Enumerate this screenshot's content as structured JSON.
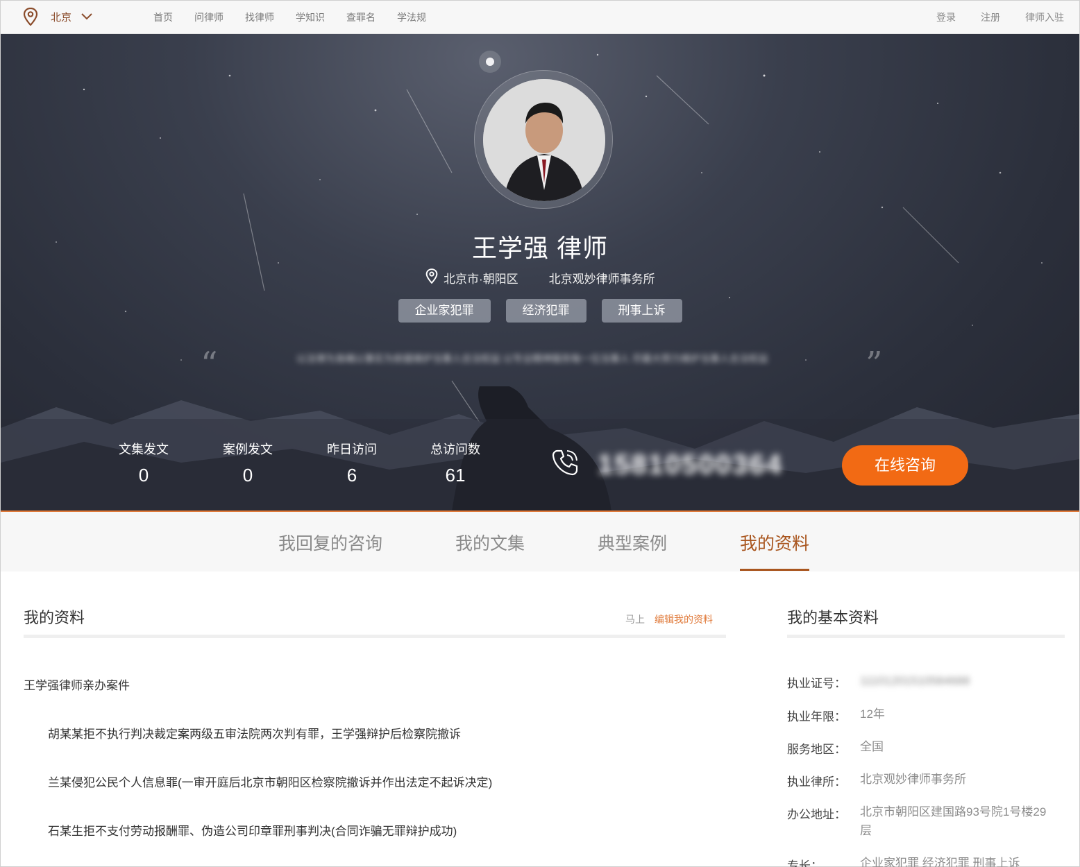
{
  "nav": {
    "city": "北京",
    "menu": [
      "首页",
      "问律师",
      "找律师",
      "学知识",
      "查罪名",
      "学法规"
    ],
    "right": [
      "登录",
      "注册",
      "律师入驻"
    ]
  },
  "profile": {
    "name": "王学强 律师",
    "location": "北京市·朝阳区",
    "firm": "北京观妙律师事务所",
    "tags": [
      "企业家犯罪",
      "经济犯罪",
      "刑事上诉"
    ],
    "quote_open": "“",
    "quote_close": "”",
    "motto": "以法律为准绳以事实为依据维护当事人合法权益 以专业精神服务每一位当事人 尽最大努力维护当事人合法权益"
  },
  "stats": [
    {
      "label": "文集发文",
      "value": "0"
    },
    {
      "label": "案例发文",
      "value": "0"
    },
    {
      "label": "昨日访问",
      "value": "6"
    },
    {
      "label": "总访问数",
      "value": "61"
    }
  ],
  "phone": "15810500364",
  "consult_label": "在线咨询",
  "tabs": [
    {
      "label": "我回复的咨询",
      "active": false
    },
    {
      "label": "我的文集",
      "active": false
    },
    {
      "label": "典型案例",
      "active": false
    },
    {
      "label": "我的资料",
      "active": true
    }
  ],
  "main": {
    "title": "我的资料",
    "edit_prefix": "马上",
    "edit_link": "编辑我的资料",
    "case_heading": "王学强律师亲办案件",
    "cases": [
      "胡某某拒不执行判决裁定案两级五审法院两次判有罪，王学强辩护后检察院撤诉",
      "兰某侵犯公民个人信息罪(一审开庭后北京市朝阳区检察院撤诉并作出法定不起诉决定)",
      "石某生拒不支付劳动报酬罪、伪造公司印章罪刑事判决(合同诈骗无罪辩护成功)"
    ]
  },
  "side": {
    "title": "我的基本资料",
    "rows": [
      {
        "k": "执业证号：",
        "v": "11101201510584688"
      },
      {
        "k": "执业年限：",
        "v": "12年"
      },
      {
        "k": "服务地区：",
        "v": "全国"
      },
      {
        "k": "执业律所：",
        "v": "北京观妙律师事务所"
      },
      {
        "k": "办公地址：",
        "v": "北京市朝阳区建国路93号院1号楼29层"
      },
      {
        "k": "专长：",
        "v": "企业家犯罪 经济犯罪 刑事上诉"
      }
    ]
  },
  "colors": {
    "accent": "#f26a14",
    "brand": "#a9561f"
  }
}
